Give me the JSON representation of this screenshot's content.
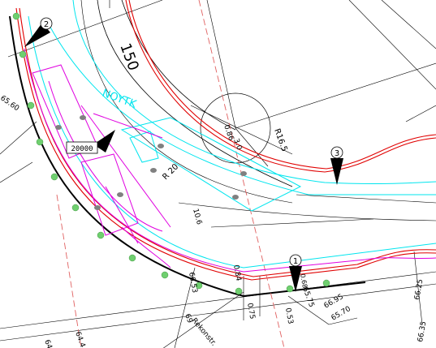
{
  "colors": {
    "black": "#000000",
    "red": "#e00000",
    "cyan": "#00e5ee",
    "magenta": "#e000e0",
    "green": "#6fcf6f",
    "gray": "#808080",
    "dash_red": "#e06060"
  },
  "labels": {
    "road_number": "150",
    "radius_16": "R16.5",
    "radius_20": "R 20",
    "dim_086": "0.86",
    "dim_30": "3.0",
    "dim_106": "10.6",
    "dim_084": "0.84",
    "dim_075": "0.75",
    "dim_053": "0.53",
    "dim_6553": "66.53",
    "dim_6575": "65.75",
    "dim_6595": "66.95",
    "dim_6570": "65.70",
    "dim_6625": "66.25",
    "dim_6635": "66.35",
    "dim_6560": "65.60",
    "dim_64": "64",
    "dim_64b": "64.4",
    "dim_69": "69",
    "dim_068": "0.68",
    "box_value": "20000",
    "road_text": "Rekonstr.",
    "cyan_text": "NOYTK"
  },
  "markers": [
    {
      "id": "marker-1",
      "label": "1"
    },
    {
      "id": "marker-2",
      "label": "2"
    },
    {
      "id": "marker-3",
      "label": "3"
    }
  ]
}
